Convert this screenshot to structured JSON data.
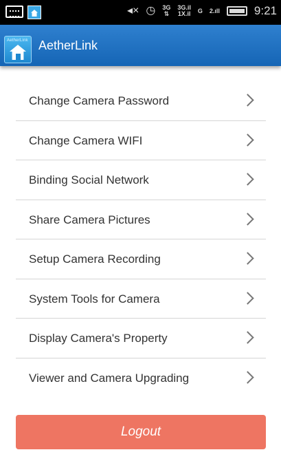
{
  "status_bar": {
    "icons": [
      "keyboard-icon",
      "app-notification-icon",
      "mute-icon",
      "alarm-icon",
      "network-3g-icon",
      "signal-icon",
      "network-g-icon",
      "signal-bars-icon",
      "battery-icon"
    ],
    "network_label_1": "3G",
    "network_label_2": "G",
    "time": "9:21"
  },
  "action_bar": {
    "title": "AetherLink",
    "logo_icon": "aetherlink-logo-icon"
  },
  "menu": {
    "items": [
      {
        "label": "Change Camera Password"
      },
      {
        "label": "Change Camera WIFI"
      },
      {
        "label": "Binding Social Network"
      },
      {
        "label": "Share Camera Pictures"
      },
      {
        "label": "Setup Camera Recording"
      },
      {
        "label": "System Tools for Camera"
      },
      {
        "label": "Display Camera's Property"
      },
      {
        "label": "Viewer and Camera Upgrading"
      }
    ],
    "chevron_icon": "chevron-right-icon"
  },
  "logout": {
    "label": "Logout"
  },
  "colors": {
    "action_bar": "#1f72c2",
    "logout_button": "#ee7562",
    "divider": "#d5d5d5",
    "text": "#333333"
  }
}
